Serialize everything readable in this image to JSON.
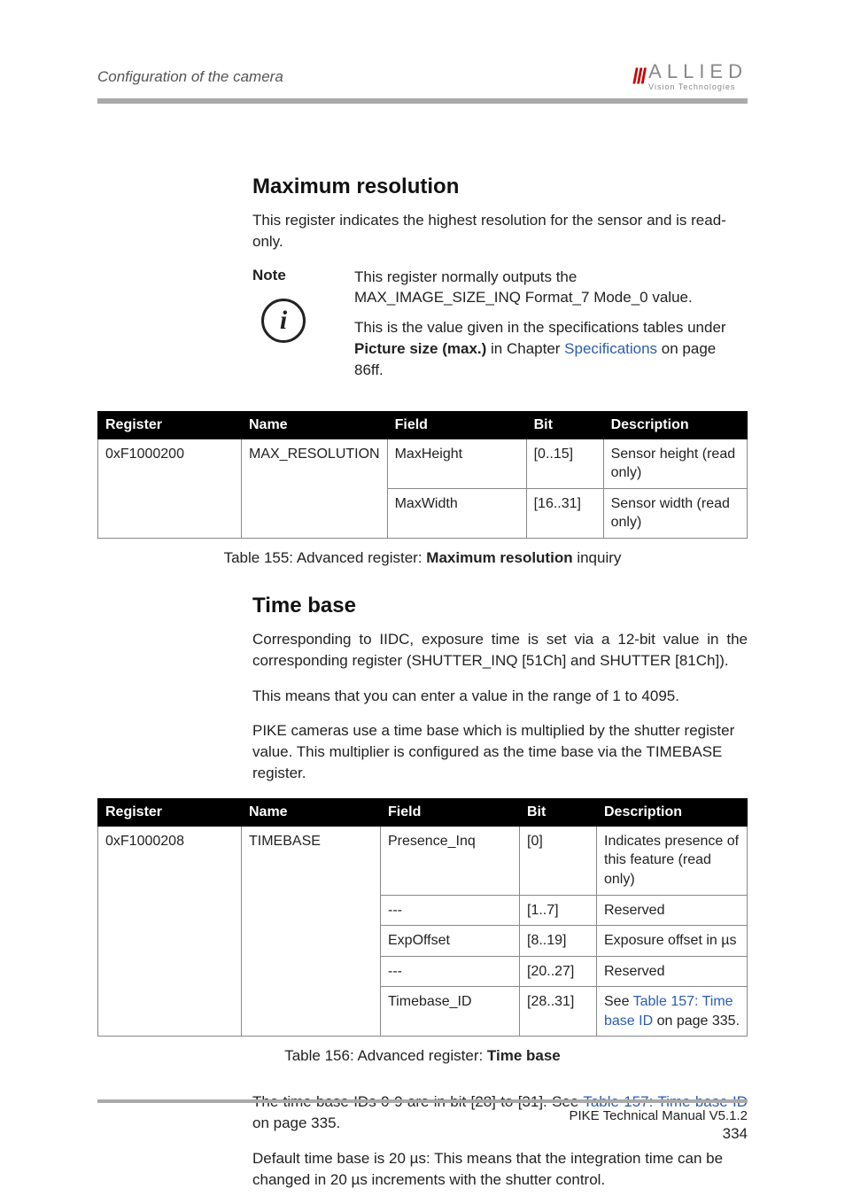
{
  "header": {
    "section_title": "Configuration of the camera",
    "logo_main": "ALLIED",
    "logo_sub": "Vision Technologies"
  },
  "section1": {
    "heading": "Maximum resolution",
    "intro": "This register indicates the highest resolution for the sensor and is read-only.",
    "note_label": "Note",
    "note_p1": "This register normally outputs the MAX_IMAGE_SIZE_INQ Format_7 Mode_0 value.",
    "note_p2_a": "This is the value given in the specifications tables under ",
    "note_p2_b": "Picture size (max.)",
    "note_p2_c": " in Chapter ",
    "note_p2_link": "Specifications",
    "note_p2_d": " on page 86ff.",
    "table_headers": {
      "register": "Register",
      "name": "Name",
      "field": "Field",
      "bit": "Bit",
      "description": "Description"
    },
    "row1": {
      "register": "0xF1000200",
      "name": "MAX_RESOLUTION",
      "field": "MaxHeight",
      "bit": "[0..15]",
      "desc": "Sensor height (read only)"
    },
    "row2": {
      "field": "MaxWidth",
      "bit": "[16..31]",
      "desc": "Sensor width (read only)"
    },
    "caption_a": "Table 155: Advanced register: ",
    "caption_b": "Maximum resolution",
    "caption_c": " inquiry"
  },
  "section2": {
    "heading": "Time base",
    "p1": "Corresponding to IIDC, exposure time is set via a 12-bit value in the corresponding register (SHUTTER_INQ [51Ch] and SHUTTER [81Ch]).",
    "p2": "This means that you can enter a value in the range of 1 to 4095.",
    "p3": "PIKE cameras use a time base which is multiplied by the shutter register value. This multiplier is configured as the time base via the TIMEBASE register.",
    "table_headers": {
      "register": "Register",
      "name": "Name",
      "field": "Field",
      "bit": "Bit",
      "description": "Description"
    },
    "row1": {
      "register": "0xF1000208",
      "name": "TIMEBASE",
      "field": "Presence_Inq",
      "bit": "[0]",
      "desc": "Indicates presence of this feature (read only)"
    },
    "row2": {
      "field": "---",
      "bit": "[1..7]",
      "desc": "Reserved"
    },
    "row3": {
      "field": "ExpOffset",
      "bit": "[8..19]",
      "desc": "Exposure offset in µs"
    },
    "row4": {
      "field": "---",
      "bit": "[20..27]",
      "desc": "Reserved"
    },
    "row5": {
      "field": "Timebase_ID",
      "bit": "[28..31]",
      "desc_a": "See ",
      "desc_link": "Table 157: Time base ID",
      "desc_b": " on page 335."
    },
    "caption_a": "Table 156: Advanced register: ",
    "caption_b": "Time base",
    "p4_a": "The time base IDs 0-9 are in bit [28] to [31]. See ",
    "p4_link": "Table 157: Time base ID",
    "p4_b": " on page 335.",
    "p5": "Default time base is 20 µs: This means that the integration time can be changed in 20 µs increments with the shutter control."
  },
  "footer": {
    "manual": "PIKE Technical Manual V5.1.2",
    "page": "334"
  }
}
